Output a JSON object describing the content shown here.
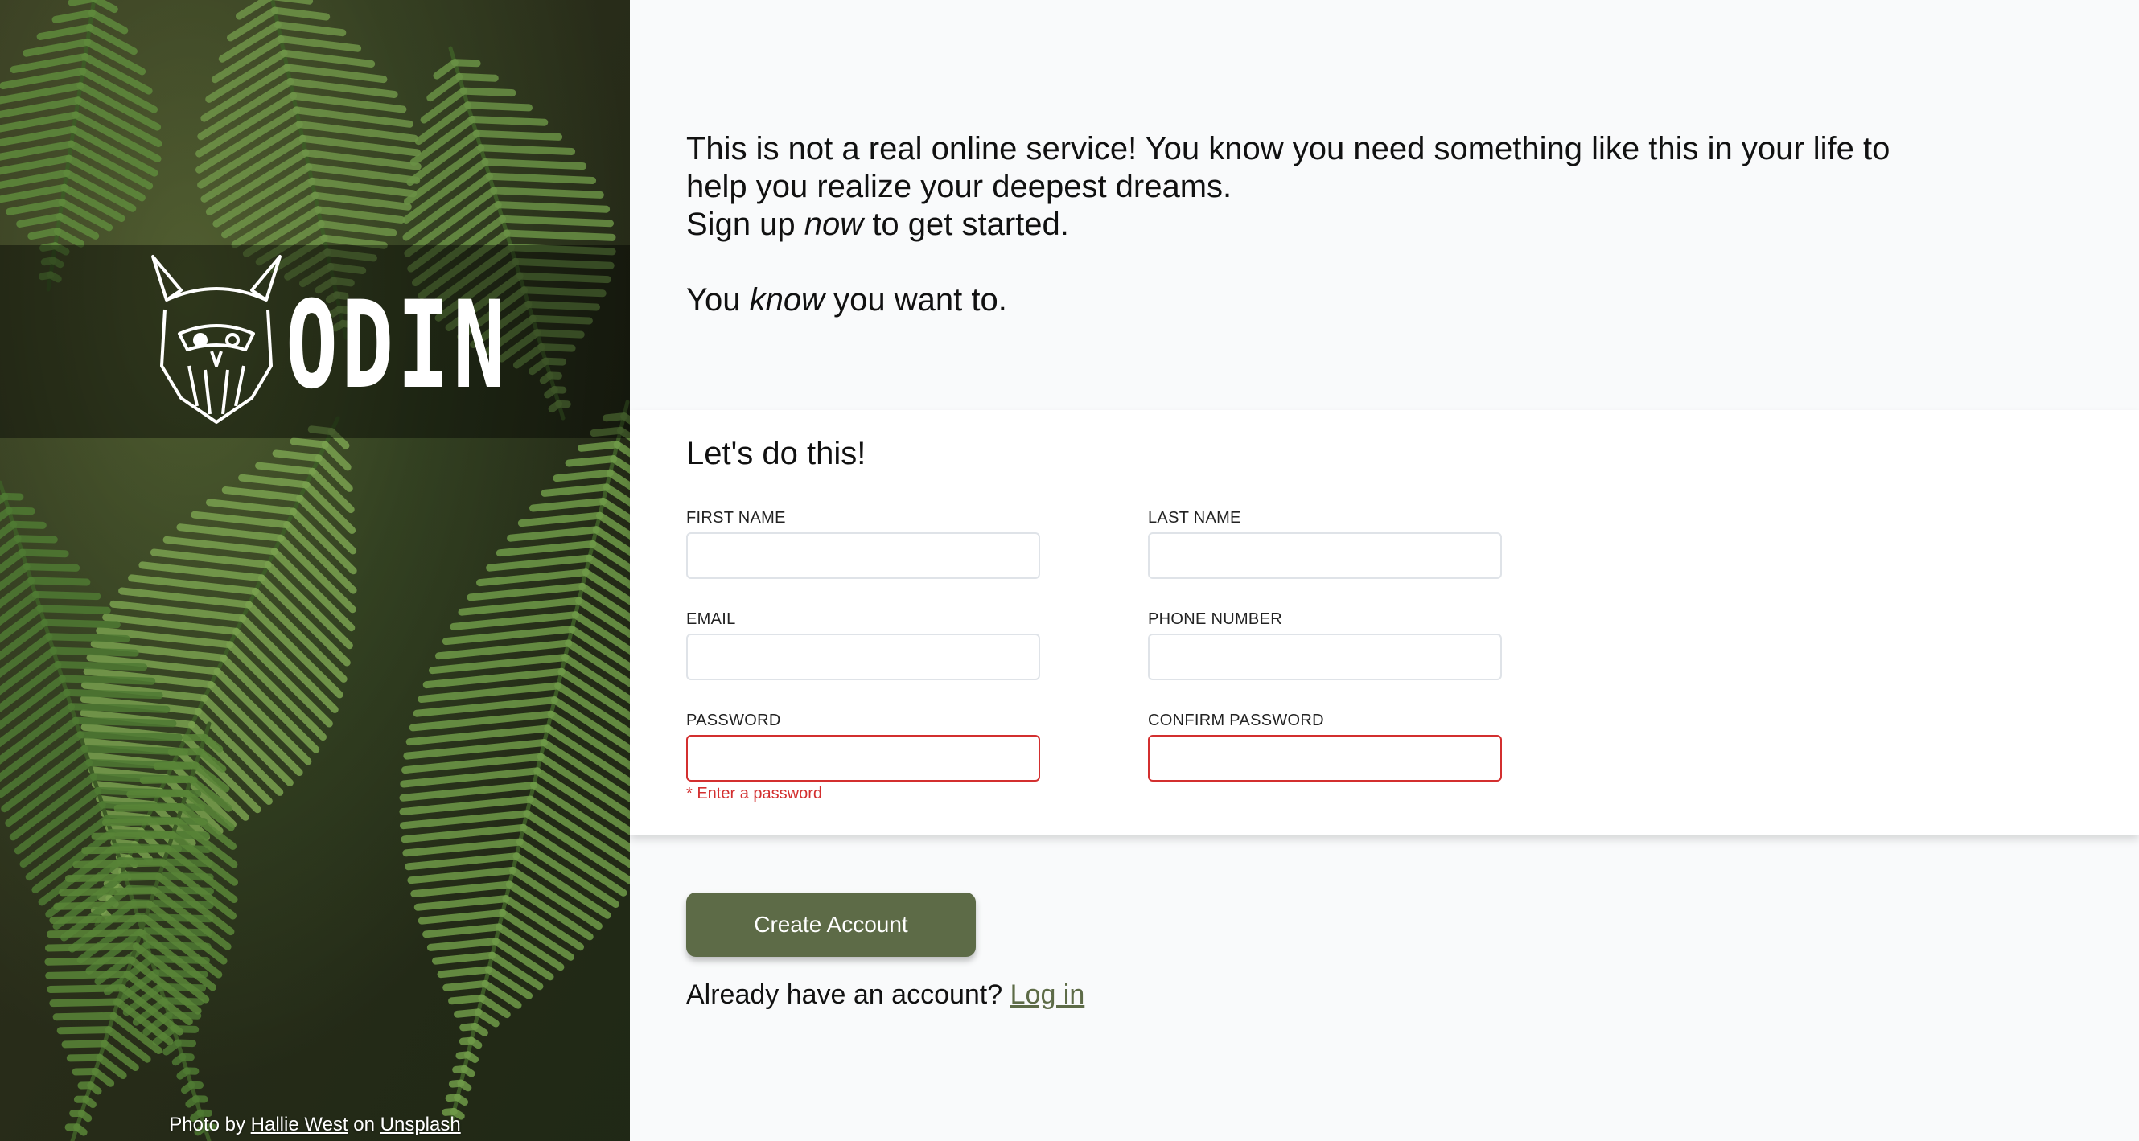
{
  "hero": {
    "logo_text": "ODIN",
    "credit": {
      "prefix": "Photo by",
      "author": "Hallie West",
      "middle": "on",
      "source": "Unsplash"
    }
  },
  "intro": {
    "line1": "This is not a real online service! You know you need something like this in your life to help you realize your deepest dreams.",
    "line2_start": "Sign up",
    "line2_em": "now",
    "line2_end": "to get started.",
    "line3_start": "You",
    "line3_em": "know",
    "line3_end": "you want to."
  },
  "form": {
    "title": "Let's do this!",
    "fields": {
      "first_name": {
        "label": "FIRST NAME",
        "value": ""
      },
      "last_name": {
        "label": "LAST NAME",
        "value": ""
      },
      "email": {
        "label": "EMAIL",
        "value": ""
      },
      "phone": {
        "label": "PHONE NUMBER",
        "value": ""
      },
      "password": {
        "label": "PASSWORD",
        "value": "",
        "error": "* Enter a password"
      },
      "confirm_password": {
        "label": "CONFIRM PASSWORD",
        "value": ""
      }
    }
  },
  "actions": {
    "create_label": "Create Account",
    "login_prompt": "Already have an account?",
    "login_link": "Log in"
  },
  "colors": {
    "accent": "#5d6b47",
    "error": "#d32f2f",
    "page_bg": "#f9fafb",
    "card_bg": "#ffffff"
  }
}
